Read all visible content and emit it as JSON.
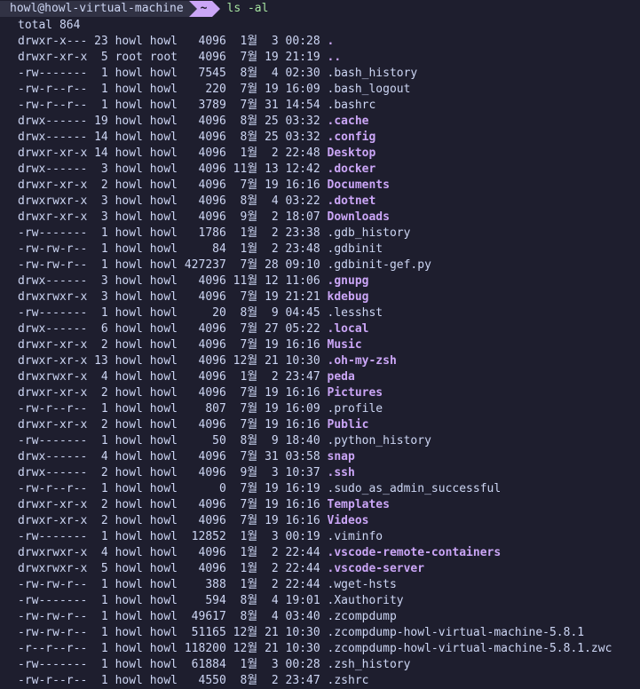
{
  "prompt": {
    "host": "howl@howl-virtual-machine",
    "dir": "~",
    "command": "ls -al"
  },
  "total_line": "total 864",
  "rows": [
    {
      "text": "drwxr-x--- 23 howl howl   4096  1월  3 00:28 ",
      "name": ".",
      "dir": true
    },
    {
      "text": "drwxr-xr-x  5 root root   4096  7월 19 21:19 ",
      "name": "..",
      "dir": true
    },
    {
      "text": "-rw-------  1 howl howl   7545  8월  4 02:30 ",
      "name": ".bash_history",
      "dir": false
    },
    {
      "text": "-rw-r--r--  1 howl howl    220  7월 19 16:09 ",
      "name": ".bash_logout",
      "dir": false
    },
    {
      "text": "-rw-r--r--  1 howl howl   3789  7월 31 14:54 ",
      "name": ".bashrc",
      "dir": false
    },
    {
      "text": "drwx------ 19 howl howl   4096  8월 25 03:32 ",
      "name": ".cache",
      "dir": true
    },
    {
      "text": "drwx------ 14 howl howl   4096  8월 25 03:32 ",
      "name": ".config",
      "dir": true
    },
    {
      "text": "drwxr-xr-x 14 howl howl   4096  1월  2 22:48 ",
      "name": "Desktop",
      "dir": true
    },
    {
      "text": "drwx------  3 howl howl   4096 11월 13 12:42 ",
      "name": ".docker",
      "dir": true
    },
    {
      "text": "drwxr-xr-x  2 howl howl   4096  7월 19 16:16 ",
      "name": "Documents",
      "dir": true
    },
    {
      "text": "drwxrwxr-x  3 howl howl   4096  8월  4 03:22 ",
      "name": ".dotnet",
      "dir": true
    },
    {
      "text": "drwxr-xr-x  3 howl howl   4096  9월  2 18:07 ",
      "name": "Downloads",
      "dir": true
    },
    {
      "text": "-rw-------  1 howl howl   1786  1월  2 23:38 ",
      "name": ".gdb_history",
      "dir": false
    },
    {
      "text": "-rw-rw-r--  1 howl howl     84  1월  2 23:48 ",
      "name": ".gdbinit",
      "dir": false
    },
    {
      "text": "-rw-rw-r--  1 howl howl 427237  7월 28 09:10 ",
      "name": ".gdbinit-gef.py",
      "dir": false
    },
    {
      "text": "drwx------  3 howl howl   4096 11월 12 11:06 ",
      "name": ".gnupg",
      "dir": true
    },
    {
      "text": "drwxrwxr-x  3 howl howl   4096  7월 19 21:21 ",
      "name": "kdebug",
      "dir": true
    },
    {
      "text": "-rw-------  1 howl howl     20  8월  9 04:45 ",
      "name": ".lesshst",
      "dir": false
    },
    {
      "text": "drwx------  6 howl howl   4096  7월 27 05:22 ",
      "name": ".local",
      "dir": true
    },
    {
      "text": "drwxr-xr-x  2 howl howl   4096  7월 19 16:16 ",
      "name": "Music",
      "dir": true
    },
    {
      "text": "drwxr-xr-x 13 howl howl   4096 12월 21 10:30 ",
      "name": ".oh-my-zsh",
      "dir": true
    },
    {
      "text": "drwxrwxr-x  4 howl howl   4096  1월  2 23:47 ",
      "name": "peda",
      "dir": true
    },
    {
      "text": "drwxr-xr-x  2 howl howl   4096  7월 19 16:16 ",
      "name": "Pictures",
      "dir": true
    },
    {
      "text": "-rw-r--r--  1 howl howl    807  7월 19 16:09 ",
      "name": ".profile",
      "dir": false
    },
    {
      "text": "drwxr-xr-x  2 howl howl   4096  7월 19 16:16 ",
      "name": "Public",
      "dir": true
    },
    {
      "text": "-rw-------  1 howl howl     50  8월  9 18:40 ",
      "name": ".python_history",
      "dir": false
    },
    {
      "text": "drwx------  4 howl howl   4096  7월 31 03:58 ",
      "name": "snap",
      "dir": true
    },
    {
      "text": "drwx------  2 howl howl   4096  9월  3 10:37 ",
      "name": ".ssh",
      "dir": true
    },
    {
      "text": "-rw-r--r--  1 howl howl      0  7월 19 16:19 ",
      "name": ".sudo_as_admin_successful",
      "dir": false
    },
    {
      "text": "drwxr-xr-x  2 howl howl   4096  7월 19 16:16 ",
      "name": "Templates",
      "dir": true
    },
    {
      "text": "drwxr-xr-x  2 howl howl   4096  7월 19 16:16 ",
      "name": "Videos",
      "dir": true
    },
    {
      "text": "-rw-------  1 howl howl  12852  1월  3 00:19 ",
      "name": ".viminfo",
      "dir": false
    },
    {
      "text": "drwxrwxr-x  4 howl howl   4096  1월  2 22:44 ",
      "name": ".vscode-remote-containers",
      "dir": true
    },
    {
      "text": "drwxrwxr-x  5 howl howl   4096  1월  2 22:44 ",
      "name": ".vscode-server",
      "dir": true
    },
    {
      "text": "-rw-rw-r--  1 howl howl    388  1월  2 22:44 ",
      "name": ".wget-hsts",
      "dir": false
    },
    {
      "text": "-rw-------  1 howl howl    594  8월  4 19:01 ",
      "name": ".Xauthority",
      "dir": false
    },
    {
      "text": "-rw-rw-r--  1 howl howl  49617  8월  4 03:40 ",
      "name": ".zcompdump",
      "dir": false
    },
    {
      "text": "-rw-rw-r--  1 howl howl  51165 12월 21 10:30 ",
      "name": ".zcompdump-howl-virtual-machine-5.8.1",
      "dir": false
    },
    {
      "text": "-r--r--r--  1 howl howl 118200 12월 21 10:30 ",
      "name": ".zcompdump-howl-virtual-machine-5.8.1.zwc",
      "dir": false
    },
    {
      "text": "-rw-------  1 howl howl  61884  1월  3 00:28 ",
      "name": ".zsh_history",
      "dir": false
    },
    {
      "text": "-rw-r--r--  1 howl howl   4550  8월  2 23:47 ",
      "name": ".zshrc",
      "dir": false
    }
  ],
  "colors": {
    "background": "#1e1e2e",
    "text": "#cdd6f4",
    "directory": "#cba6f7",
    "command": "#a6e3a1",
    "host_segment": "#313244",
    "dir_segment": "#cba6f7"
  },
  "icons": {
    "os_icon": "apple-icon"
  }
}
